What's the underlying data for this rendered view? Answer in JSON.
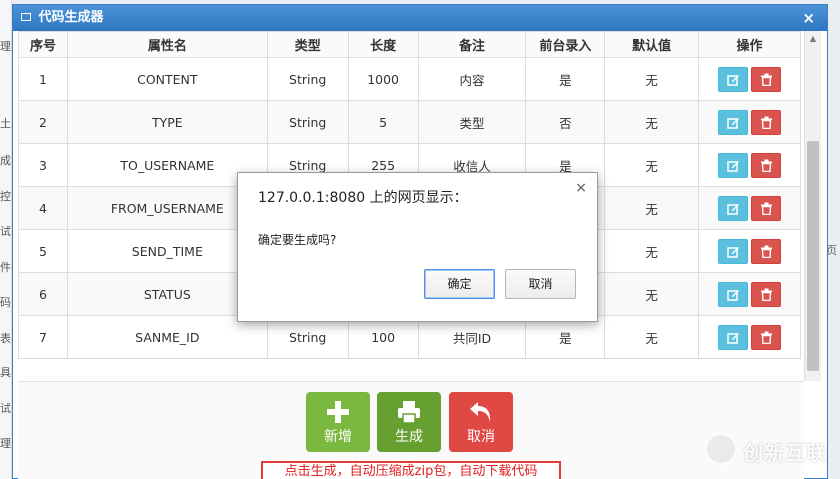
{
  "background": {
    "left_chars": [
      "理",
      "土",
      "成",
      "控",
      "试",
      "件",
      "码",
      "表",
      "具",
      "试",
      "理"
    ],
    "right_char": "页"
  },
  "window": {
    "title": "代码生成器",
    "close_glyph": "×"
  },
  "table": {
    "columns": [
      "序号",
      "属性名",
      "类型",
      "长度",
      "备注",
      "前台录入",
      "默认值",
      "操作"
    ],
    "rows": [
      [
        "1",
        "CONTENT",
        "String",
        "1000",
        "内容",
        "是",
        "无"
      ],
      [
        "2",
        "TYPE",
        "String",
        "5",
        "类型",
        "否",
        "无"
      ],
      [
        "3",
        "TO_USERNAME",
        "String",
        "255",
        "收信人",
        "是",
        "无"
      ],
      [
        "4",
        "FROM_USERNAME",
        "",
        "",
        "",
        "",
        "无"
      ],
      [
        "5",
        "SEND_TIME",
        "",
        "",
        "",
        "",
        "无"
      ],
      [
        "6",
        "STATUS",
        "",
        "",
        "",
        "",
        "无"
      ],
      [
        "7",
        "SANME_ID",
        "String",
        "100",
        "共同ID",
        "是",
        "无"
      ]
    ]
  },
  "footer": {
    "add_label": "新增",
    "generate_label": "生成",
    "cancel_label": "取消",
    "note": "点击生成，自动压缩成zip包，自动下载代码"
  },
  "dialog": {
    "title": "127.0.0.1:8080 上的网页显示：",
    "message": "确定要生成吗?",
    "ok_label": "确定",
    "cancel_label": "取消",
    "close_glyph": "×"
  },
  "watermark": {
    "text": "创新互联"
  }
}
